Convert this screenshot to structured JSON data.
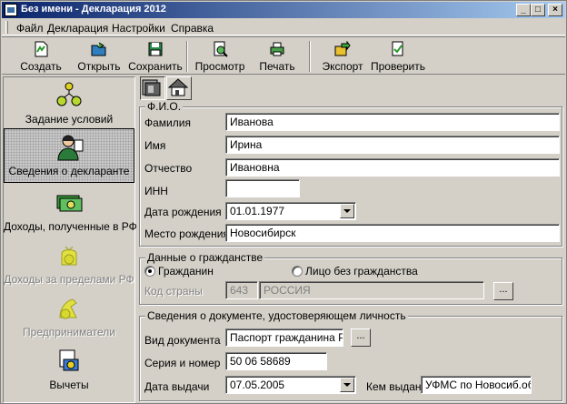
{
  "window": {
    "title": "Без имени - Декларация 2012",
    "minimize": "_",
    "maximize": "□",
    "close": "×"
  },
  "menu": [
    "Файл",
    "Декларация",
    "Настройки",
    "Справка"
  ],
  "toolbar": [
    "Создать",
    "Открыть",
    "Сохранить",
    "Просмотр",
    "Печать",
    "Экспорт",
    "Проверить"
  ],
  "left_panel": [
    {
      "label": "Задание условий",
      "icon": "conditions-icon",
      "state": "normal"
    },
    {
      "label": "Сведения о декларанте",
      "icon": "declarant-icon",
      "state": "selected"
    },
    {
      "label": "Доходы, полученные в РФ",
      "icon": "income-rf-icon",
      "state": "normal"
    },
    {
      "label": "Доходы за пределами РФ",
      "icon": "income-abroad-icon",
      "state": "disabled"
    },
    {
      "label": "Предприниматели",
      "icon": "entrepreneurs-icon",
      "state": "disabled"
    },
    {
      "label": "Вычеты",
      "icon": "deductions-icon",
      "state": "normal"
    }
  ],
  "fio": {
    "title": "Ф.И.О.",
    "surname_label": "Фамилия",
    "surname": "Иванова",
    "name_label": "Имя",
    "name": "Ирина",
    "patronymic_label": "Отчество",
    "patronymic": "Ивановна",
    "inn_label": "ИНН",
    "inn": "",
    "birthdate_label": "Дата рождения",
    "birthdate": "01.01.1977",
    "birthplace_label": "Место рождения",
    "birthplace": "Новосибирск"
  },
  "citizenship": {
    "title": "Данные о гражданстве",
    "citizen_label": "Гражданин",
    "stateless_label": "Лицо без гражданства",
    "selected": "citizen",
    "country_code_label": "Код страны",
    "country_code": "643",
    "country_name": "РОССИЯ",
    "browse": "..."
  },
  "document": {
    "title": "Сведения о документе, удостоверяющем личность",
    "type_label": "Вид документа",
    "type": "Паспорт гражданина РФ",
    "browse": "...",
    "number_label": "Серия и номер",
    "number": "50 06 58689",
    "issue_date_label": "Дата выдачи",
    "issue_date": "07.05.2005",
    "issued_by_label": "Кем выдан",
    "issued_by": "УФМС по Новосиб.обл."
  },
  "colors": {
    "titlebar_start": "#0a246a",
    "titlebar_end": "#a6caf0",
    "face": "#d4d0c8"
  }
}
